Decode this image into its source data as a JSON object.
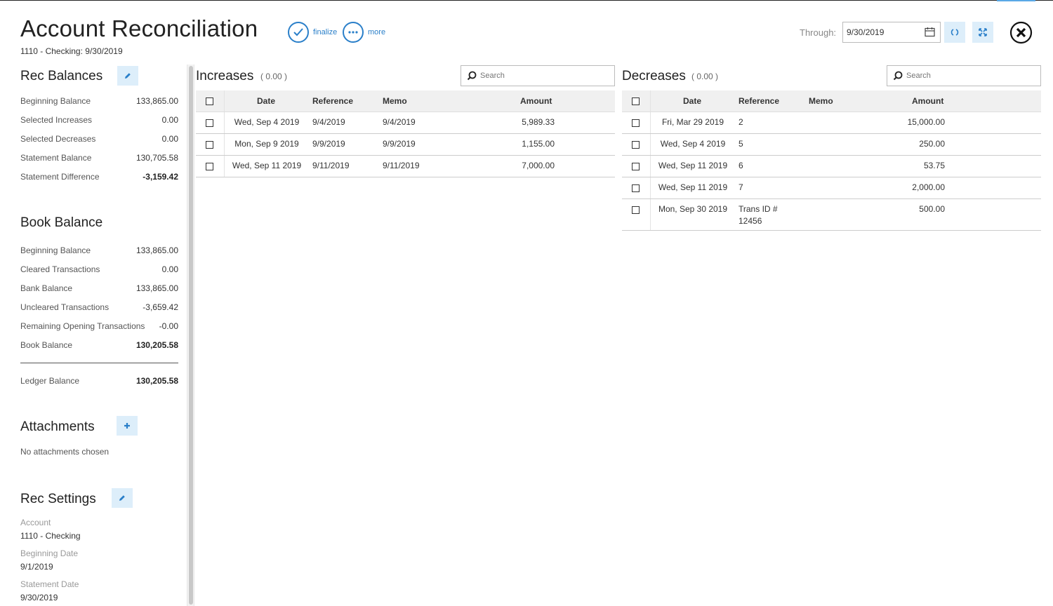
{
  "header": {
    "title": "Account Reconciliation",
    "subtitle": "1110 - Checking: 9/30/2019",
    "finalize_label": "finalize",
    "more_label": "more",
    "through_label": "Through:",
    "through_value": "9/30/2019"
  },
  "rec_balances": {
    "title": "Rec Balances",
    "items": [
      {
        "label": "Beginning Balance",
        "value": "133,865.00"
      },
      {
        "label": "Selected Increases",
        "value": "0.00"
      },
      {
        "label": "Selected Decreases",
        "value": "0.00"
      },
      {
        "label": "Statement Balance",
        "value": "130,705.58"
      },
      {
        "label": "Statement Difference",
        "value": "-3,159.42"
      }
    ]
  },
  "book_balance": {
    "title": "Book Balance",
    "items": [
      {
        "label": "Beginning Balance",
        "value": "133,865.00"
      },
      {
        "label": "Cleared Transactions",
        "value": "0.00"
      },
      {
        "label": "Bank Balance",
        "value": "133,865.00"
      },
      {
        "label": "Uncleared Transactions",
        "value": "-3,659.42"
      },
      {
        "label": "Remaining Opening Transactions",
        "value": "-0.00"
      },
      {
        "label": "Book Balance",
        "value": "130,205.58"
      }
    ],
    "ledger_label": "Ledger Balance",
    "ledger_value": "130,205.58"
  },
  "attachments": {
    "title": "Attachments",
    "empty_text": "No attachments chosen"
  },
  "rec_settings": {
    "title": "Rec Settings",
    "account_label": "Account",
    "account_value": "1110 - Checking",
    "begin_label": "Beginning Date",
    "begin_value": "9/1/2019",
    "stmt_label": "Statement Date",
    "stmt_value": "9/30/2019"
  },
  "increases": {
    "title": "Increases",
    "count": "( 0.00 )",
    "search_placeholder": "Search",
    "columns": {
      "date": "Date",
      "reference": "Reference",
      "memo": "Memo",
      "amount": "Amount"
    },
    "rows": [
      {
        "date": "Wed, Sep 4 2019",
        "reference": "9/4/2019",
        "memo": "9/4/2019",
        "amount": "5,989.33"
      },
      {
        "date": "Mon, Sep 9 2019",
        "reference": "9/9/2019",
        "memo": "9/9/2019",
        "amount": "1,155.00"
      },
      {
        "date": "Wed, Sep 11 2019",
        "reference": "9/11/2019",
        "memo": "9/11/2019",
        "amount": "7,000.00"
      }
    ]
  },
  "decreases": {
    "title": "Decreases",
    "count": "( 0.00 )",
    "search_placeholder": "Search",
    "columns": {
      "date": "Date",
      "reference": "Reference",
      "memo": "Memo",
      "amount": "Amount"
    },
    "rows": [
      {
        "date": "Fri, Mar 29 2019",
        "reference": "2",
        "reference2": "",
        "memo": "",
        "amount": "15,000.00"
      },
      {
        "date": "Wed, Sep 4 2019",
        "reference": "5",
        "reference2": "",
        "memo": "",
        "amount": "250.00"
      },
      {
        "date": "Wed, Sep 11 2019",
        "reference": "6",
        "reference2": "",
        "memo": "",
        "amount": "53.75"
      },
      {
        "date": "Wed, Sep 11 2019",
        "reference": "7",
        "reference2": "",
        "memo": "",
        "amount": "2,000.00"
      },
      {
        "date": "Mon, Sep 30 2019",
        "reference": "Trans ID #",
        "reference2": "12456",
        "memo": "",
        "amount": "500.00"
      }
    ]
  },
  "colors": {
    "accent": "#2a7fc9",
    "button_bg": "#ddeefa",
    "header_bg": "#f0f0f0"
  },
  "icons": [
    "check-icon",
    "more-icon",
    "calendar-icon",
    "refresh-icon",
    "expand-icon",
    "close-icon",
    "pencil-icon",
    "plus-icon",
    "search-icon"
  ]
}
